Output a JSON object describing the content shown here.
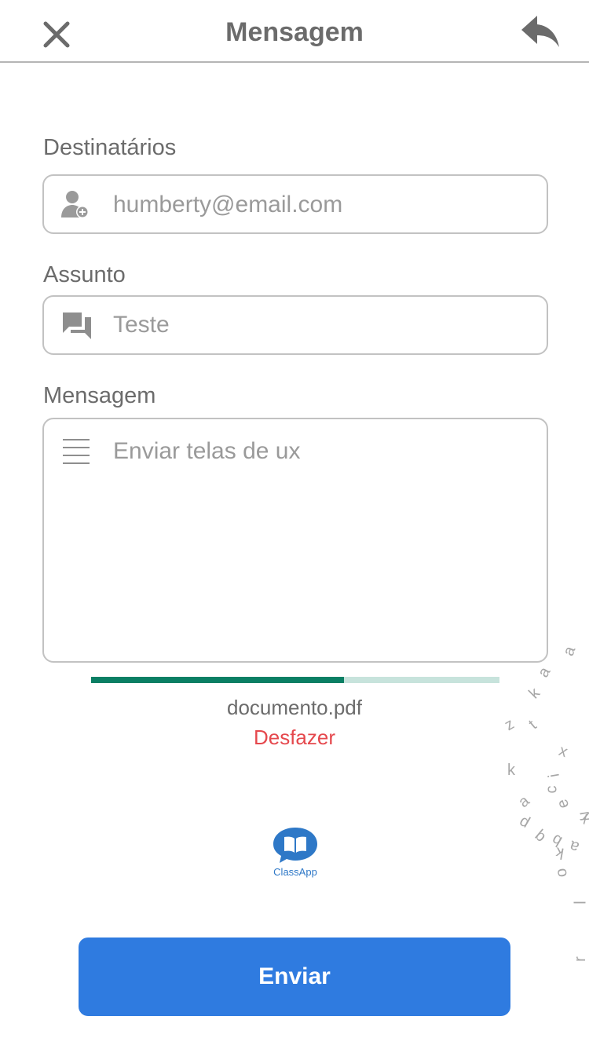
{
  "header": {
    "title": "Mensagem",
    "close_icon": "close-icon",
    "reply_icon": "reply-icon"
  },
  "recipients": {
    "label": "Destinatários",
    "value": "humberty@email.com",
    "icon": "add-user-icon"
  },
  "subject": {
    "label": "Assunto",
    "value": "Teste",
    "icon": "chat-icon"
  },
  "message": {
    "label": "Mensagem",
    "value": "Enviar telas de ux",
    "icon": "text-lines-icon"
  },
  "attachment": {
    "filename": "documento.pdf",
    "undo_label": "Desfazer",
    "progress": 0.62
  },
  "logo": {
    "text": "ClassApp",
    "icon": "book-icon"
  },
  "send_button": {
    "label": "Enviar"
  },
  "decorative_letters": [
    "a",
    "a",
    "k",
    "z",
    "t",
    "x",
    "k",
    "i",
    "c",
    "a",
    "e",
    "v",
    "p",
    "q",
    "b",
    "a",
    "k",
    "x",
    "o",
    "l",
    "r"
  ],
  "colors": {
    "accent": "#2f7be0",
    "progress": "#0a7f64",
    "progress_track": "#c7e3dc",
    "undo": "#e5484d",
    "text": "#6b6b6b"
  }
}
